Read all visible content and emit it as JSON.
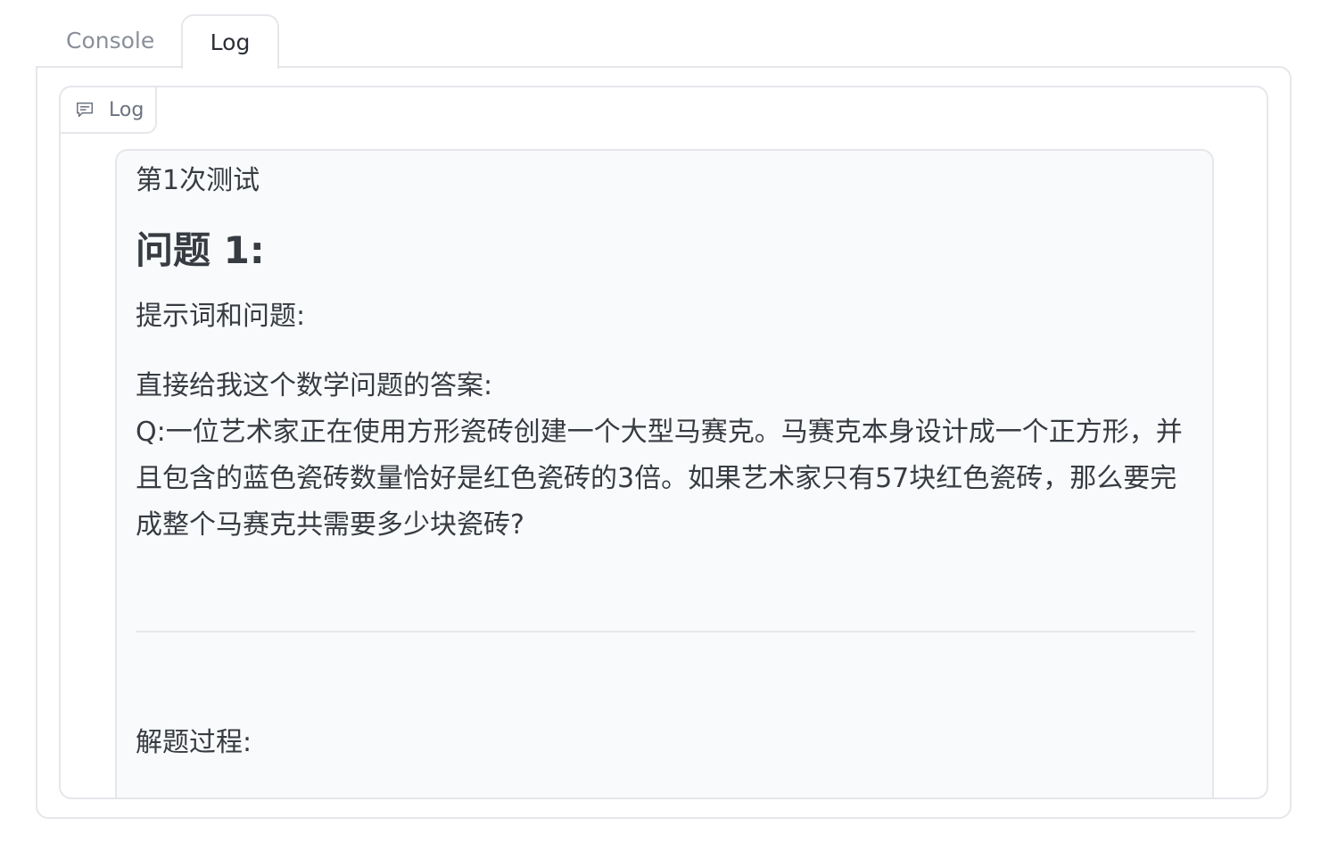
{
  "tabs": [
    {
      "label": "Console",
      "active": false
    },
    {
      "label": "Log",
      "active": true
    }
  ],
  "log_block": {
    "label": "Log",
    "icon": "chat-icon"
  },
  "message": {
    "run_title": "第1次测试",
    "question_heading": "问题 1:",
    "prompt_label": "提示词和问题:",
    "prompt_body": "直接给我这个数学问题的答案:\nQ:一位艺术家正在使用方形瓷砖创建一个大型马赛克。马赛克本身设计成一个正方形，并且包含的蓝色瓷砖数量恰好是红色瓷砖的3倍。如果艺术家只有57块红色瓷砖，那么要完成整个马赛克共需要多少块瓷砖?",
    "solution_label": "解题过程:"
  },
  "colors": {
    "border": "#e5e7eb",
    "message_bg": "#f9fafb",
    "text": "#373b42",
    "inactive_tab": "#8a8f99"
  }
}
